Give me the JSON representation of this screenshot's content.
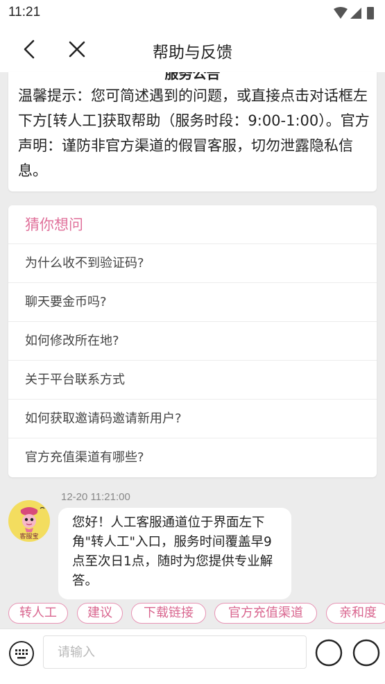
{
  "status_bar": {
    "time": "11:21",
    "icons": [
      "wifi-icon",
      "signal-icon",
      "battery-icon"
    ]
  },
  "header": {
    "title": "帮助与反馈",
    "back_icon": "chevron-left-icon",
    "close_icon": "close-icon"
  },
  "notice": {
    "title": "服务公告",
    "text": "温馨提示：您可简述遇到的问题，或直接点击对话框左下方[转人工]获取帮助（服务时段：9:00-1:00）。官方声明：谨防非官方渠道的假冒客服，切勿泄露隐私信息。"
  },
  "faq": {
    "heading": "猜你想问",
    "items": [
      "为什么收不到验证码?",
      "聊天要金币吗?",
      "如何修改所在地?",
      "关于平台联系方式",
      "如何获取邀请码邀请新用户?",
      "官方充值渠道有哪些?"
    ]
  },
  "chat": {
    "timestamp": "12-20 11:21:00",
    "avatar_label": "客服宝",
    "message": "您好！人工客服通道位于界面左下角\"转人工\"入口，服务时间覆盖早9点至次日1点，随时为您提供专业解答。"
  },
  "quick_replies": [
    "转人工",
    "建议",
    "下载链接",
    "官方充值渠道",
    "亲和度"
  ],
  "input": {
    "placeholder": "请输入"
  },
  "colors": {
    "accent_pink": "#e0709a",
    "chip_border": "#e893b4",
    "background": "#ececec"
  }
}
